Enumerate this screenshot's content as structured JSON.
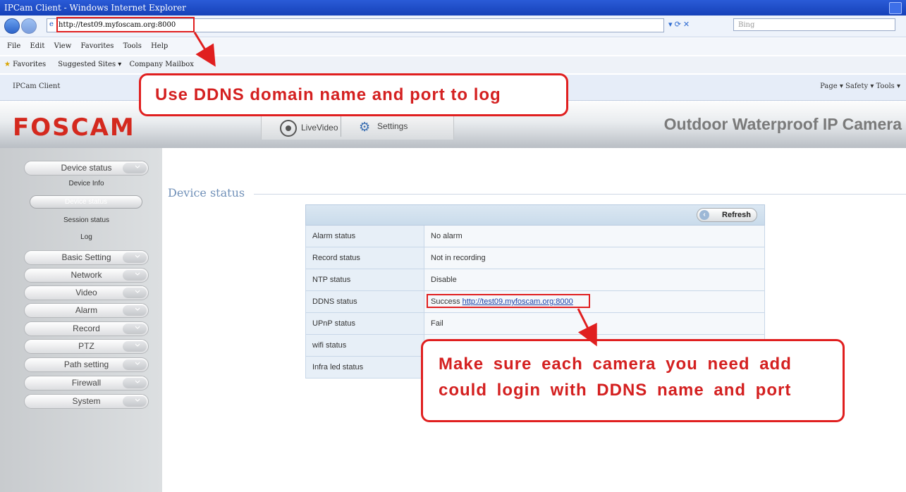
{
  "browser": {
    "title": "IPCam Client - Windows Internet Explorer",
    "address": "http://test09.myfoscam.org:8000",
    "search_placeholder": "Bing",
    "menu": [
      "File",
      "Edit",
      "View",
      "Favorites",
      "Tools",
      "Help"
    ],
    "favorites": "Favorites",
    "suggested": "Suggested Sites ▾",
    "company_mailbox": "Company Mailbox",
    "tab_title": "IPCam Client",
    "tab_tools": "Page ▾  Safety ▾  Tools ▾"
  },
  "header": {
    "logo": "FOSCAM",
    "tab_livevideo": "LiveVideo",
    "tab_settings": "Settings",
    "camera_title": "Outdoor Waterproof IP Camera"
  },
  "sidebar": {
    "device_status": "Device status",
    "sub": [
      "Device Info",
      "Device status",
      "Session status",
      "Log"
    ],
    "items": [
      "Basic Setting",
      "Network",
      "Video",
      "Alarm",
      "Record",
      "PTZ",
      "Path setting",
      "Firewall",
      "System"
    ]
  },
  "main": {
    "title": "Device status",
    "refresh": "Refresh",
    "rows": [
      {
        "label": "Alarm status",
        "value": "No alarm"
      },
      {
        "label": "Record status",
        "value": "Not in recording"
      },
      {
        "label": "NTP status",
        "value": "Disable"
      },
      {
        "label": "DDNS status",
        "value": "Success",
        "link": "http://test09.myfoscam.org:8000"
      },
      {
        "label": "UPnP status",
        "value": "Fail"
      },
      {
        "label": "wifi status",
        "value": ""
      },
      {
        "label": "Infra led status",
        "value": ""
      }
    ]
  },
  "annotations": {
    "top": "Use DDNS domain name and port to log",
    "bottom_line1": "Make sure each camera you need add",
    "bottom_line2": "could login with DDNS name and port"
  },
  "colors": {
    "accent_red": "#e01f1f",
    "logo_red": "#d4291e"
  }
}
